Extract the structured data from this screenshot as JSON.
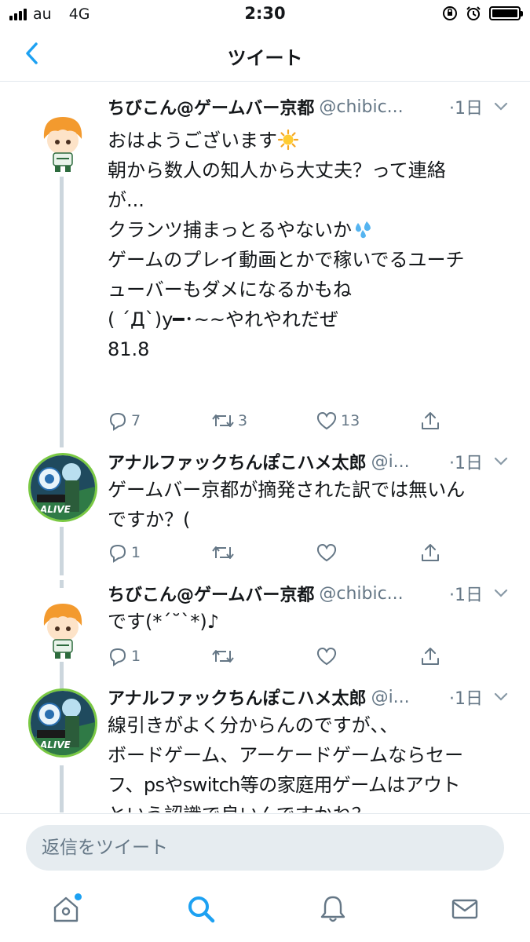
{
  "status_bar": {
    "carrier": "au",
    "network": "4G",
    "time": "2:30"
  },
  "nav": {
    "title": "ツイート"
  },
  "tweets": [
    {
      "name": "ちびこん@ゲームバー京都",
      "handle": "@chibic...",
      "time": "·1日",
      "lines": [
        "おはようございます",
        "朝から数人の知人から大丈夫？って連絡",
        "が...",
        "クランツ捕まっとるやないか",
        "",
        "ゲームのプレイ動画とかで稼いでるユーチ",
        "ューバーもダメになるかもね",
        "",
        "( ´Д`)y━･~~やれやれだぜ",
        "81.8"
      ],
      "emoji_after_line0": "sun-emoji",
      "emoji_after_line3": "sweat-drops-emoji",
      "reply_count": "7",
      "retweet_count": "3",
      "like_count": "13"
    },
    {
      "name": "アナルファックちんぽこハメ太郎",
      "handle": "@i...",
      "time": "·1日",
      "lines": [
        "ゲームバー京都が摘発された訳では無いん",
        "ですか？("
      ],
      "avatar_text": "ALIVE",
      "reply_count": "1",
      "retweet_count": "",
      "like_count": ""
    },
    {
      "name": "ちびこん@ゲームバー京都",
      "handle": "@chibic...",
      "time": "·1日",
      "lines": [
        "です(*´˘`*)♪"
      ],
      "reply_count": "1",
      "retweet_count": "",
      "like_count": ""
    },
    {
      "name": "アナルファックちんぽこハメ太郎",
      "handle": "@i...",
      "time": "·1日",
      "lines": [
        "線引きがよく分からんのですが、、",
        "ボードゲーム、アーケードゲームならセー",
        "フ、psやswitch等の家庭用ゲームはアウト",
        "という認識で良いんですかね？"
      ],
      "avatar_text": "ALIVE"
    }
  ],
  "reply": {
    "placeholder": "返信をツイート"
  },
  "colors": {
    "accent": "#1da1f2",
    "text": "#14171a",
    "secondary": "#657786",
    "thread_line": "#ccd6dd"
  },
  "icons": [
    "back-chevron-icon",
    "caret-down-icon",
    "reply-icon",
    "retweet-icon",
    "like-icon",
    "share-icon",
    "home-icon",
    "search-icon",
    "notifications-icon",
    "messages-icon"
  ]
}
